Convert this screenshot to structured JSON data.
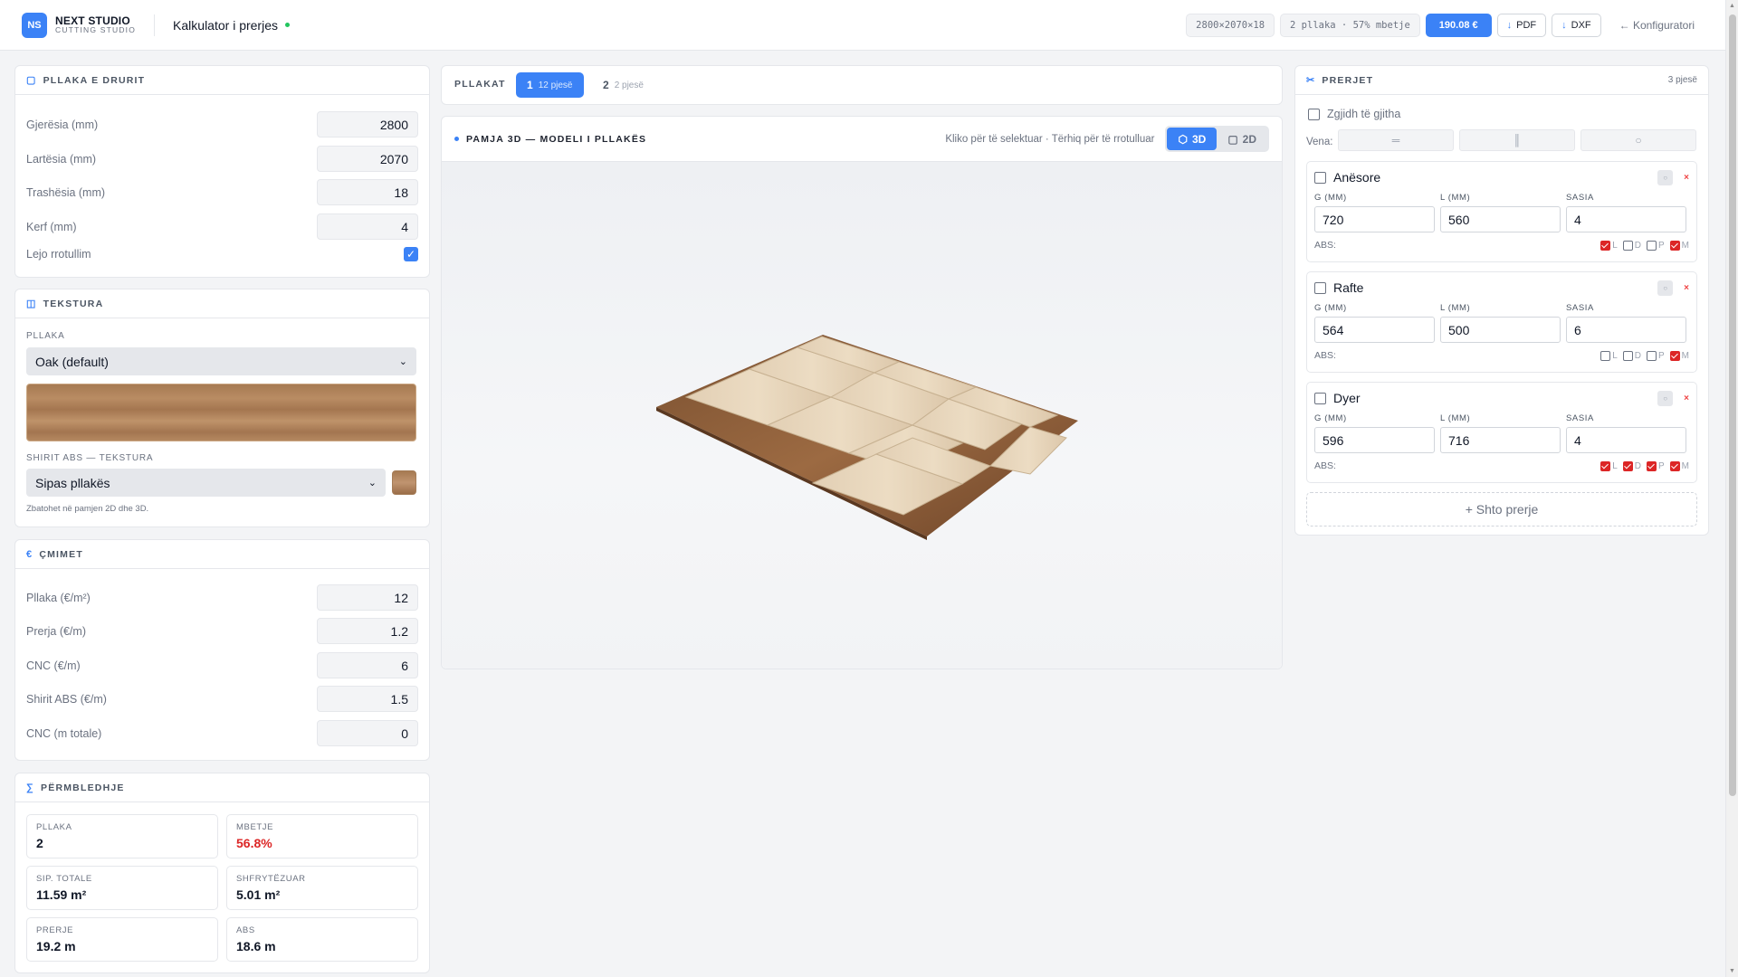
{
  "header": {
    "logo": "NS",
    "brand": "NEXT STUDIO",
    "brand_sub": "CUTTING STUDIO",
    "title": "Kalkulator i prerjes",
    "dims": "2800×2070×18",
    "sheets_info": "2 pllaka · 57% mbetje",
    "price": "190.08 €",
    "pdf": "PDF",
    "dxf": "DXF",
    "back": "← Konfiguratori"
  },
  "board": {
    "title": "PLLAKA E DRURIT",
    "fields": [
      {
        "label": "Gjerësia (mm)",
        "value": "2800"
      },
      {
        "label": "Lartësia (mm)",
        "value": "2070"
      },
      {
        "label": "Trashësia (mm)",
        "value": "18"
      },
      {
        "label": "Kerf (mm)",
        "value": "4"
      }
    ],
    "rotate_label": "Lejo rrotullim",
    "rotate_checked": true
  },
  "texture": {
    "title": "TEKSTURA",
    "board_label": "PLLAKA",
    "board_value": "Oak (default)",
    "abs_label": "SHIRIT ABS — TEKSTURA",
    "abs_value": "Sipas pllakës",
    "note": "Zbatohet në pamjen 2D dhe 3D."
  },
  "prices": {
    "title": "ÇMIMET",
    "fields": [
      {
        "label": "Pllaka (€/m²)",
        "value": "12"
      },
      {
        "label": "Prerja (€/m)",
        "value": "1.2"
      },
      {
        "label": "CNC (€/m)",
        "value": "6"
      },
      {
        "label": "Shirit ABS (€/m)",
        "value": "1.5"
      },
      {
        "label": "CNC (m totale)",
        "value": "0"
      }
    ]
  },
  "summary": {
    "title": "PËRMBLEDHJE",
    "stats": [
      {
        "key": "PLLAKA",
        "value": "2"
      },
      {
        "key": "MBETJE",
        "value": "56.8%"
      },
      {
        "key": "SIP. TOTALE",
        "value": "11.59 m²"
      },
      {
        "key": "SHFRYTËZUAR",
        "value": "5.01 m²"
      },
      {
        "key": "PRERJE",
        "value": "19.2 m"
      },
      {
        "key": "ABS",
        "value": "18.6 m"
      }
    ]
  },
  "sheets": {
    "label": "PLLAKAT",
    "tabs": [
      {
        "num": "1",
        "sub": "12 pjesë"
      },
      {
        "num": "2",
        "sub": "2 pjesë"
      }
    ]
  },
  "view": {
    "title": "PAMJA 3D — MODELI I PLLAKËS",
    "hint": "Kliko për të selektuar · Tërhiq për të rrotulluar",
    "btn_3d": "3D",
    "btn_2d": "2D"
  },
  "cuts": {
    "title": "PRERJET",
    "count": "3 pjesë",
    "select_all": "Zgjidh të gjitha",
    "vena_label": "Vena:",
    "vena_opts": [
      "═",
      "║",
      "○"
    ],
    "col_g": "G (MM)",
    "col_l": "L (MM)",
    "col_q": "SASIA",
    "abs_label": "ABS:",
    "items": [
      {
        "name": "Anësore",
        "g": "720",
        "l": "560",
        "q": "4",
        "flags": [
          "L",
          "D",
          "P",
          "M"
        ],
        "on": [
          true,
          false,
          false,
          true
        ]
      },
      {
        "name": "Rafte",
        "g": "564",
        "l": "500",
        "q": "6",
        "flags": [
          "L",
          "D",
          "P",
          "M"
        ],
        "on": [
          false,
          false,
          false,
          true
        ]
      },
      {
        "name": "Dyer",
        "g": "596",
        "l": "716",
        "q": "4",
        "flags": [
          "L",
          "D",
          "P",
          "M"
        ],
        "on": [
          true,
          true,
          true,
          true
        ]
      }
    ],
    "add": "+ Shto prerje"
  },
  "colors": {
    "accent": "#3b82f6",
    "danger": "#dc2626",
    "wood": "#b98c63"
  }
}
